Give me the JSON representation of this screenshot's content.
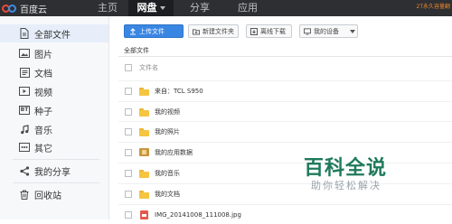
{
  "nav": {
    "logo_text": "百度云",
    "items": [
      {
        "label": "主页"
      },
      {
        "label": "网盘",
        "active": true
      },
      {
        "label": "分享"
      },
      {
        "label": "应用"
      }
    ],
    "promo_text": "2T永久容量翻",
    "active_color": "#1d1e21"
  },
  "sidebar": {
    "items": [
      {
        "label": "全部文件",
        "icon": "document-icon",
        "active": true
      },
      {
        "label": "图片",
        "icon": "image-icon"
      },
      {
        "label": "文档",
        "icon": "file-text-icon"
      },
      {
        "label": "视频",
        "icon": "video-icon"
      },
      {
        "label": "种子",
        "icon": "bt-icon",
        "icon_text": "BT"
      },
      {
        "label": "音乐",
        "icon": "music-icon"
      },
      {
        "label": "其它",
        "icon": "more-icon"
      },
      {
        "label": "我的分享",
        "icon": "share-icon"
      },
      {
        "label": "回收站",
        "icon": "trash-icon"
      }
    ]
  },
  "toolbar": {
    "upload_label": "上传文件",
    "new_folder_label": "新建文件夹",
    "offline_download_label": "离线下载",
    "my_devices_label": "我的设备",
    "primary_color": "#3a86e3"
  },
  "breadcrumb": "全部文件",
  "list": {
    "column_filename": "文件名",
    "rows": [
      {
        "name": "来自：TCL S950",
        "type": "folder"
      },
      {
        "name": "我的视频",
        "type": "folder"
      },
      {
        "name": "我的照片",
        "type": "folder"
      },
      {
        "name": "我的应用数据",
        "type": "app-folder"
      },
      {
        "name": "我的音乐",
        "type": "folder"
      },
      {
        "name": "我的文档",
        "type": "folder"
      },
      {
        "name": "IMG_20141008_111008.jpg",
        "type": "image"
      }
    ]
  },
  "watermark": {
    "title": "百科全说",
    "subtitle": "助你轻松解决",
    "color": "#1f7a5a"
  }
}
